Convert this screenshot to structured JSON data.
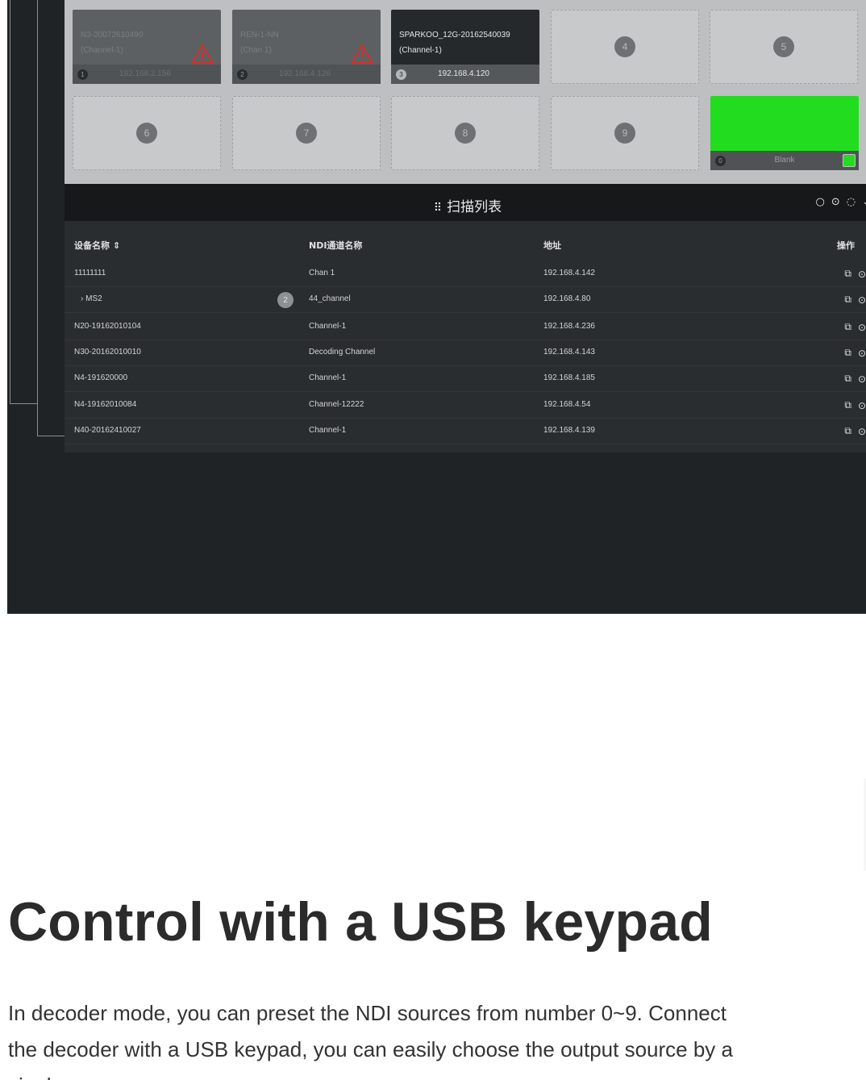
{
  "preset_grid": {
    "sources": [
      {
        "slot": "1",
        "name": "N3-20072610490",
        "channel": "(Channel-1)",
        "ip": "192.168.2.156",
        "warning": true,
        "active": false
      },
      {
        "slot": "2",
        "name": "REN-1-NN",
        "channel": "(Chan 1)",
        "ip": "192.168.4.126",
        "warning": true,
        "active": false
      },
      {
        "slot": "3",
        "name": "SPARKOO_12G-20162540039",
        "channel": "(Channel-1)",
        "ip": "192.168.4.120",
        "warning": false,
        "active": true
      }
    ],
    "empty_slots": [
      "4",
      "5",
      "6",
      "7",
      "8",
      "9"
    ],
    "blank": {
      "slot": "0",
      "label": "Blank",
      "color": "#22dd1f"
    }
  },
  "scan_list": {
    "title": "扫描列表",
    "title_icon": "list-icon",
    "columns": {
      "device": "设备名称 ⇕",
      "ndi": "NDI通道名称",
      "address": "地址",
      "ops": "操作"
    },
    "rows": [
      {
        "device": "11111111",
        "ndi": "Chan 1",
        "address": "192.168.4.142"
      },
      {
        "device": "› MS2",
        "count": "2",
        "ndi": "44_channel",
        "address": "192.168.4.80"
      },
      {
        "device": "N20-19162010104",
        "ndi": "Channel-1",
        "address": "192.168.4.236"
      },
      {
        "device": "N30-20162010010",
        "ndi": "Decoding Channel",
        "address": "192.168.4.143"
      },
      {
        "device": "N4-191620000",
        "ndi": "Channel-1",
        "address": "192.168.4.185"
      },
      {
        "device": "N4-19162010084",
        "ndi": "Channel-12222",
        "address": "192.168.4.54"
      },
      {
        "device": "N40-20162410027",
        "ndi": "Channel-1",
        "address": "192.168.4.139"
      }
    ],
    "row_action_icons": [
      "link-icon",
      "target-icon"
    ],
    "header_tools": [
      "search-icon",
      "target-icon",
      "refresh-icon",
      "chevron-down-icon"
    ]
  },
  "article": {
    "heading": "Control with a USB keypad",
    "body": "In decoder mode, you can preset the NDI sources from number 0~9. Connect the decoder with a USB keypad, you can easily choose the output source by a single press."
  }
}
